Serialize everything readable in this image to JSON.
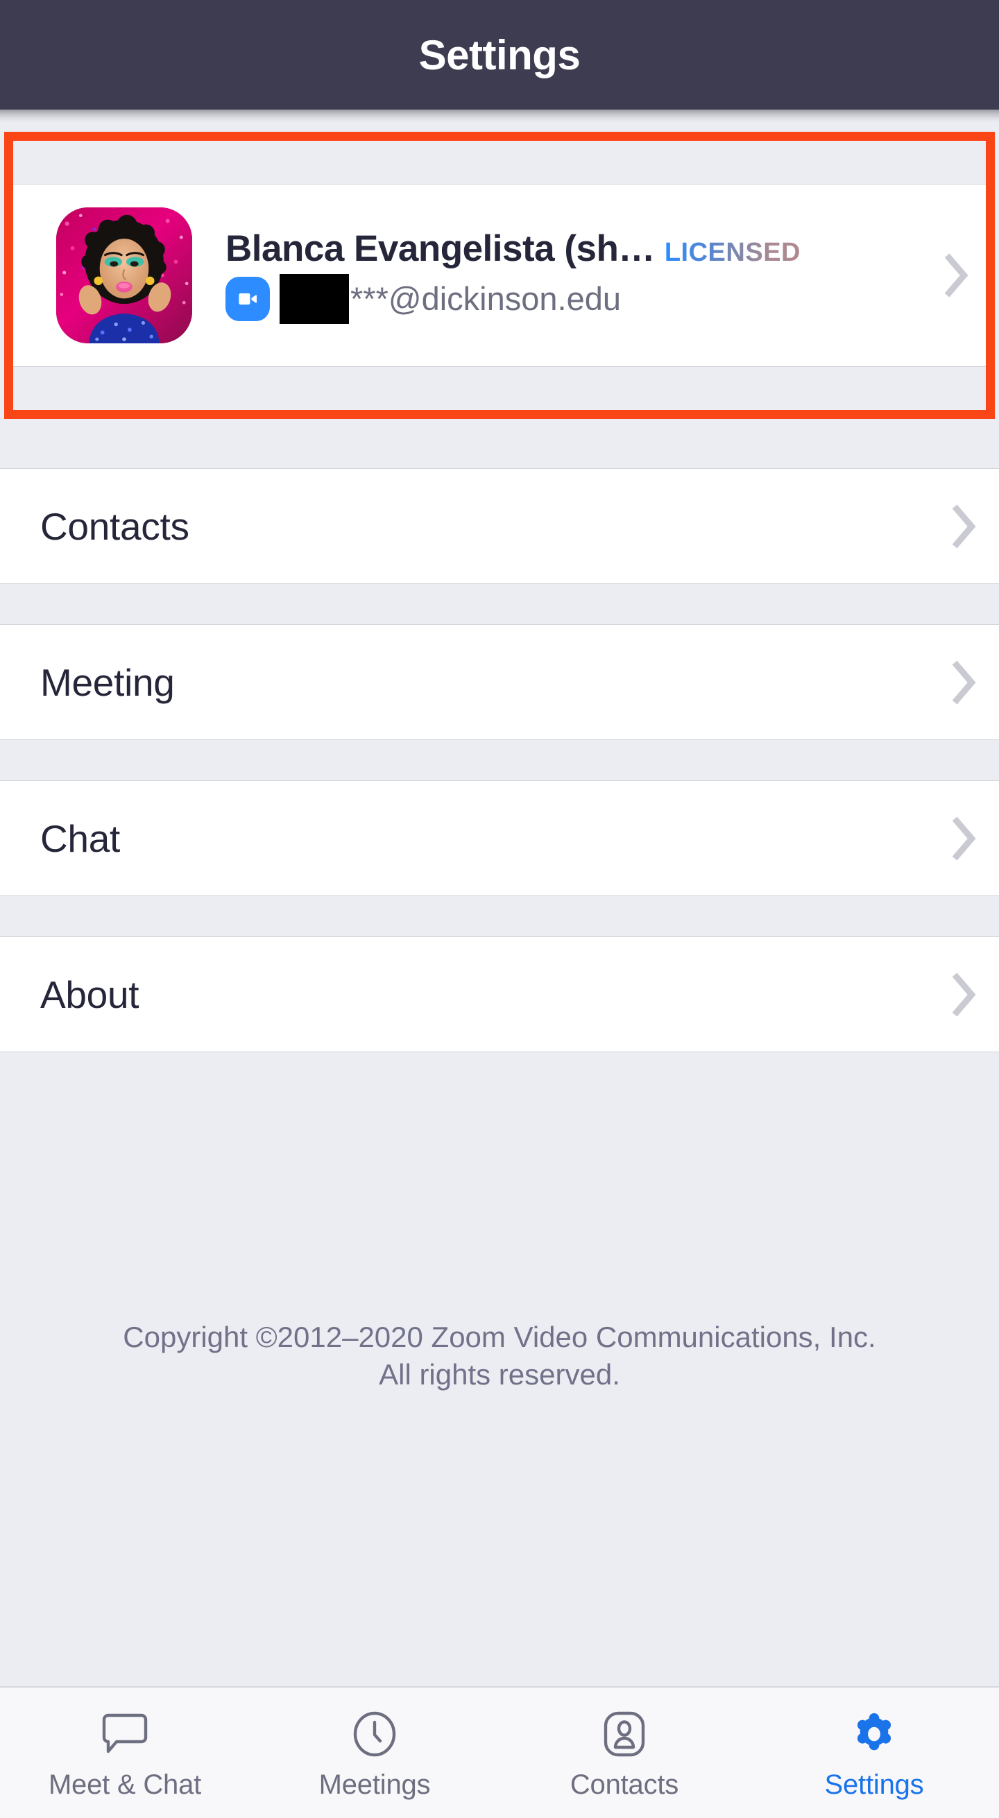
{
  "header": {
    "title": "Settings"
  },
  "profile": {
    "name": "Blanca Evangelista (sh…",
    "license_badge": "LICENSED",
    "email": "***@dickinson.edu",
    "email_redacted": true,
    "avatar_icon": "user-avatar-photo",
    "zoom_icon": "zoom-video-icon",
    "chevron_icon": "chevron-right-icon",
    "highlighted": true,
    "highlight_color": "#fa4616"
  },
  "menu": {
    "items": [
      {
        "label": "Contacts",
        "chevron_icon": "chevron-right-icon"
      },
      {
        "label": "Meeting",
        "chevron_icon": "chevron-right-icon"
      },
      {
        "label": "Chat",
        "chevron_icon": "chevron-right-icon"
      },
      {
        "label": "About",
        "chevron_icon": "chevron-right-icon"
      }
    ]
  },
  "footer": {
    "copyright_line1": "Copyright ©2012–2020 Zoom Video Communications, Inc.",
    "copyright_line2": "All rights reserved."
  },
  "tabbar": {
    "tabs": [
      {
        "label": "Meet & Chat",
        "icon": "chat-bubble-icon",
        "active": false
      },
      {
        "label": "Meetings",
        "icon": "clock-icon",
        "active": false
      },
      {
        "label": "Contacts",
        "icon": "person-card-icon",
        "active": false
      },
      {
        "label": "Settings",
        "icon": "gear-icon",
        "active": true
      }
    ],
    "active_color": "#1a73e8",
    "inactive_color": "#6d6e80"
  }
}
